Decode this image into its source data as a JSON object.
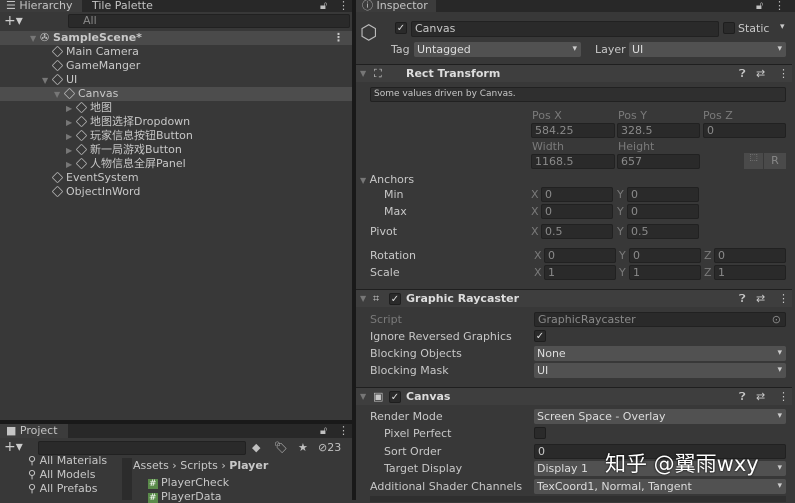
{
  "hierarchy": {
    "tab": "Hierarchy",
    "tab2": "Tile Palette",
    "search_placeholder": "All",
    "scene": "SampleScene*",
    "items": [
      {
        "label": "Main Camera",
        "depth": 1,
        "arrow": ""
      },
      {
        "label": "GameManger",
        "depth": 1,
        "arrow": ""
      },
      {
        "label": "UI",
        "depth": 1,
        "arrow": "▼"
      },
      {
        "label": "Canvas",
        "depth": 2,
        "arrow": "▼",
        "selected": true
      },
      {
        "label": "地图",
        "depth": 3,
        "arrow": "▶"
      },
      {
        "label": "地图选择Dropdown",
        "depth": 3,
        "arrow": "▶"
      },
      {
        "label": "玩家信息按钮Button",
        "depth": 3,
        "arrow": "▶"
      },
      {
        "label": "新一局游戏Button",
        "depth": 3,
        "arrow": "▶"
      },
      {
        "label": "人物信息全屏Panel",
        "depth": 3,
        "arrow": "▶"
      },
      {
        "label": "EventSystem",
        "depth": 1,
        "arrow": ""
      },
      {
        "label": "ObjectInWord",
        "depth": 1,
        "arrow": ""
      }
    ]
  },
  "project": {
    "tab": "Project",
    "hidden_count": "23",
    "left": [
      "All Materials",
      "All Models",
      "All Prefabs"
    ],
    "breadcrumb": [
      "Assets",
      "Scripts",
      "Player"
    ],
    "files": [
      "PlayerCheck",
      "PlayerData"
    ]
  },
  "inspector": {
    "tab": "Inspector",
    "name": "Canvas",
    "static_label": "Static",
    "tag_label": "Tag",
    "tag": "Untagged",
    "layer_label": "Layer",
    "layer": "UI",
    "rect": {
      "title": "Rect Transform",
      "note": "Some values driven by Canvas.",
      "posx_l": "Pos X",
      "posy_l": "Pos Y",
      "posz_l": "Pos Z",
      "posx": "584.25",
      "posy": "328.5",
      "posz": "0",
      "width_l": "Width",
      "height_l": "Height",
      "width": "1168.5",
      "height": "657",
      "r_btn": "R",
      "anchors": "Anchors",
      "min": "Min",
      "max": "Max",
      "pivot": "Pivot",
      "rotation": "Rotation",
      "scale": "Scale",
      "x": "X",
      "y": "Y",
      "z": "Z",
      "min_x": "0",
      "min_y": "0",
      "max_x": "0",
      "max_y": "0",
      "pivot_x": "0.5",
      "pivot_y": "0.5",
      "rot_x": "0",
      "rot_y": "0",
      "rot_z": "0",
      "scale_x": "1",
      "scale_y": "1",
      "scale_z": "1"
    },
    "raycaster": {
      "title": "Graphic Raycaster",
      "script_l": "Script",
      "script": "GraphicRaycaster",
      "ignore_l": "Ignore Reversed Graphics",
      "ignore": true,
      "objects_l": "Blocking Objects",
      "objects": "None",
      "mask_l": "Blocking Mask",
      "mask": "UI"
    },
    "canvas": {
      "title": "Canvas",
      "render_l": "Render Mode",
      "render": "Screen Space - Overlay",
      "pixel_l": "Pixel Perfect",
      "pixel": false,
      "sort_l": "Sort Order",
      "sort": "0",
      "display_l": "Target Display",
      "display": "Display 1",
      "shader_l": "Additional Shader Channels",
      "shader": "TexCoord1, Normal, Tangent"
    }
  },
  "watermark": "知乎 @翼雨wxy"
}
